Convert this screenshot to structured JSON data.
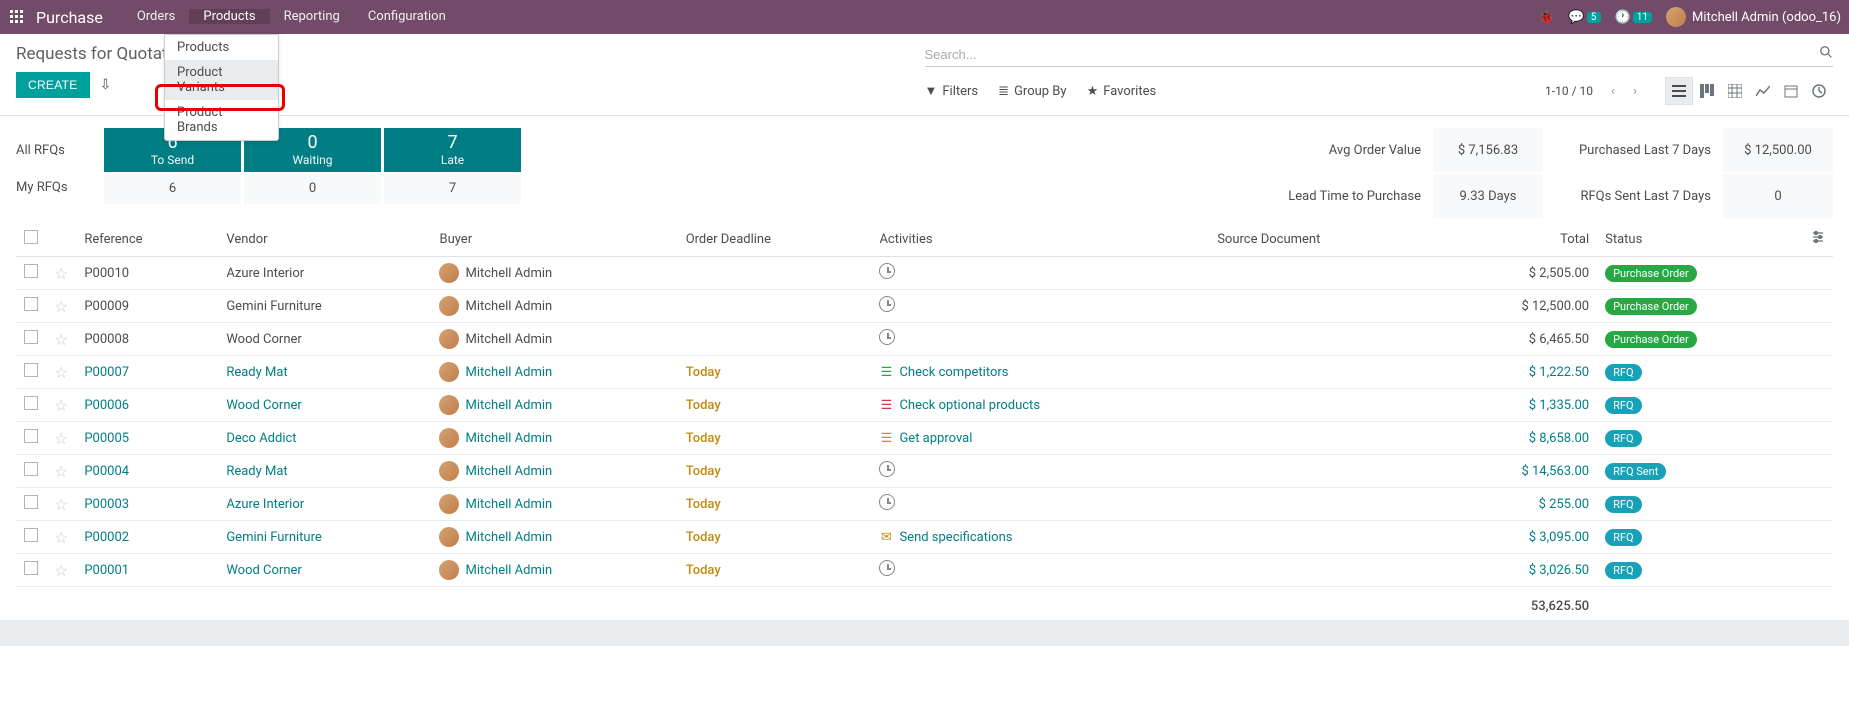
{
  "navbar": {
    "app_name": "Purchase",
    "menus": [
      "Orders",
      "Products",
      "Reporting",
      "Configuration"
    ],
    "active_menu_index": 1,
    "dropdown": [
      "Products",
      "Product Variants",
      "Product Brands"
    ],
    "dropdown_highlight_index": 1,
    "messaging_badge": "5",
    "activities_badge": "11",
    "user_name": "Mitchell Admin (odoo_16)"
  },
  "control_panel": {
    "breadcrumb": "Requests for Quotat",
    "create_label": "CREATE",
    "search_placeholder": "Search...",
    "filters_label": "Filters",
    "groupby_label": "Group By",
    "favorites_label": "Favorites",
    "pager": "1-10 / 10"
  },
  "dashboard": {
    "row_labels": [
      "All RFQs",
      "My RFQs"
    ],
    "cards": [
      {
        "num": "6",
        "label": "To Send",
        "sub": "6"
      },
      {
        "num": "0",
        "label": "Waiting",
        "sub": "0"
      },
      {
        "num": "7",
        "label": "Late",
        "sub": "7"
      }
    ],
    "stats": [
      {
        "label1": "Avg Order Value",
        "value1": "$ 7,156.83",
        "label2": "Lead Time to Purchase",
        "value2": "9.33 Days"
      },
      {
        "label1": "Purchased Last 7 Days",
        "value1": "$ 12,500.00",
        "label2": "RFQs Sent Last 7 Days",
        "value2": "0"
      }
    ]
  },
  "table": {
    "headers": {
      "reference": "Reference",
      "vendor": "Vendor",
      "buyer": "Buyer",
      "deadline": "Order Deadline",
      "activities": "Activities",
      "source": "Source Document",
      "total": "Total",
      "status": "Status"
    },
    "rows": [
      {
        "ref": "P00010",
        "ref_link": false,
        "vendor": "Azure Interior",
        "buyer": "Mitchell Admin",
        "buyer_link": false,
        "deadline": "",
        "clock": true,
        "activity": "",
        "activity_icon": "",
        "activity_color": "",
        "total": "$ 2,505.00",
        "status": "Purchase Order",
        "status_class": "status-po"
      },
      {
        "ref": "P00009",
        "ref_link": false,
        "vendor": "Gemini Furniture",
        "buyer": "Mitchell Admin",
        "buyer_link": false,
        "deadline": "",
        "clock": true,
        "activity": "",
        "activity_icon": "",
        "activity_color": "",
        "total": "$ 12,500.00",
        "status": "Purchase Order",
        "status_class": "status-po"
      },
      {
        "ref": "P00008",
        "ref_link": false,
        "vendor": "Wood Corner",
        "buyer": "Mitchell Admin",
        "buyer_link": false,
        "deadline": "",
        "clock": true,
        "activity": "",
        "activity_icon": "",
        "activity_color": "",
        "total": "$ 6,465.50",
        "status": "Purchase Order",
        "status_class": "status-po"
      },
      {
        "ref": "P00007",
        "ref_link": true,
        "vendor": "Ready Mat",
        "buyer": "Mitchell Admin",
        "buyer_link": true,
        "deadline": "Today",
        "clock": false,
        "activity": "Check competitors",
        "activity_icon": "☰",
        "activity_color": "act-green",
        "total": "$ 1,222.50",
        "status": "RFQ",
        "status_class": "status-rfq"
      },
      {
        "ref": "P00006",
        "ref_link": true,
        "vendor": "Wood Corner",
        "buyer": "Mitchell Admin",
        "buyer_link": true,
        "deadline": "Today",
        "clock": false,
        "activity": "Check optional products",
        "activity_icon": "☰",
        "activity_color": "act-red",
        "total": "$ 1,335.00",
        "status": "RFQ",
        "status_class": "status-rfq"
      },
      {
        "ref": "P00005",
        "ref_link": true,
        "vendor": "Deco Addict",
        "buyer": "Mitchell Admin",
        "buyer_link": true,
        "deadline": "Today",
        "clock": false,
        "activity": "Get approval",
        "activity_icon": "☰",
        "activity_color": "act-orange",
        "total": "$ 8,658.00",
        "status": "RFQ",
        "status_class": "status-rfq"
      },
      {
        "ref": "P00004",
        "ref_link": true,
        "vendor": "Ready Mat",
        "buyer": "Mitchell Admin",
        "buyer_link": true,
        "deadline": "Today",
        "clock": true,
        "activity": "",
        "activity_icon": "",
        "activity_color": "",
        "total": "$ 14,563.00",
        "status": "RFQ Sent",
        "status_class": "status-sent"
      },
      {
        "ref": "P00003",
        "ref_link": true,
        "vendor": "Azure Interior",
        "buyer": "Mitchell Admin",
        "buyer_link": true,
        "deadline": "Today",
        "clock": true,
        "activity": "",
        "activity_icon": "",
        "activity_color": "",
        "total": "$ 255.00",
        "status": "RFQ",
        "status_class": "status-rfq"
      },
      {
        "ref": "P00002",
        "ref_link": true,
        "vendor": "Gemini Furniture",
        "buyer": "Mitchell Admin",
        "buyer_link": true,
        "deadline": "Today",
        "clock": false,
        "activity": "Send specifications",
        "activity_icon": "✉",
        "activity_color": "act-gold",
        "total": "$ 3,095.00",
        "status": "RFQ",
        "status_class": "status-rfq"
      },
      {
        "ref": "P00001",
        "ref_link": true,
        "vendor": "Wood Corner",
        "buyer": "Mitchell Admin",
        "buyer_link": true,
        "deadline": "Today",
        "clock": true,
        "activity": "",
        "activity_icon": "",
        "activity_color": "",
        "total": "$ 3,026.50",
        "status": "RFQ",
        "status_class": "status-rfq"
      }
    ],
    "footer_total": "53,625.50"
  }
}
